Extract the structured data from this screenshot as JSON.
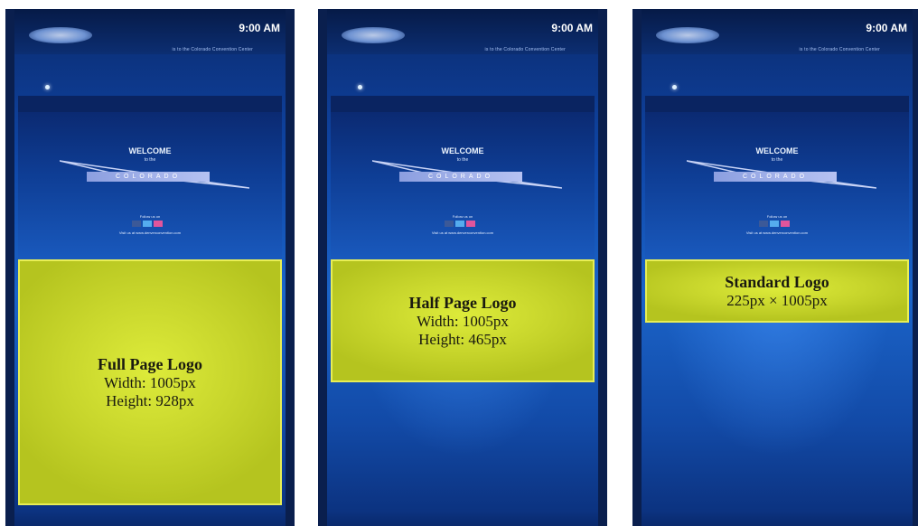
{
  "status": {
    "time": "9:00 AM",
    "subtitle": "is to the Colorado Convention Center"
  },
  "welcome": {
    "title": "WELCOME",
    "sub": "to the",
    "name": "COLORADO",
    "follow": "Follow us on",
    "visit": "Visit us at www.denverconvention.com"
  },
  "colors": {
    "accent_yellow": "#c8d62c",
    "screen_blue": "#1b64c9",
    "social_facebook": "#3b5998",
    "social_twitter": "#55acee",
    "social_flickr": "#ff0084"
  },
  "variants": [
    {
      "title": "Full Page Logo",
      "line1": "Width: 1005px",
      "line2": "Height: 928px",
      "fill": 0.5
    },
    {
      "title": "Half Page Logo",
      "line1": "Width: 1005px",
      "line2": "Height: 465px",
      "fill": 0.25
    },
    {
      "title": "Standard Logo",
      "line1": "225px × 1005px",
      "fill": 0.12
    }
  ]
}
